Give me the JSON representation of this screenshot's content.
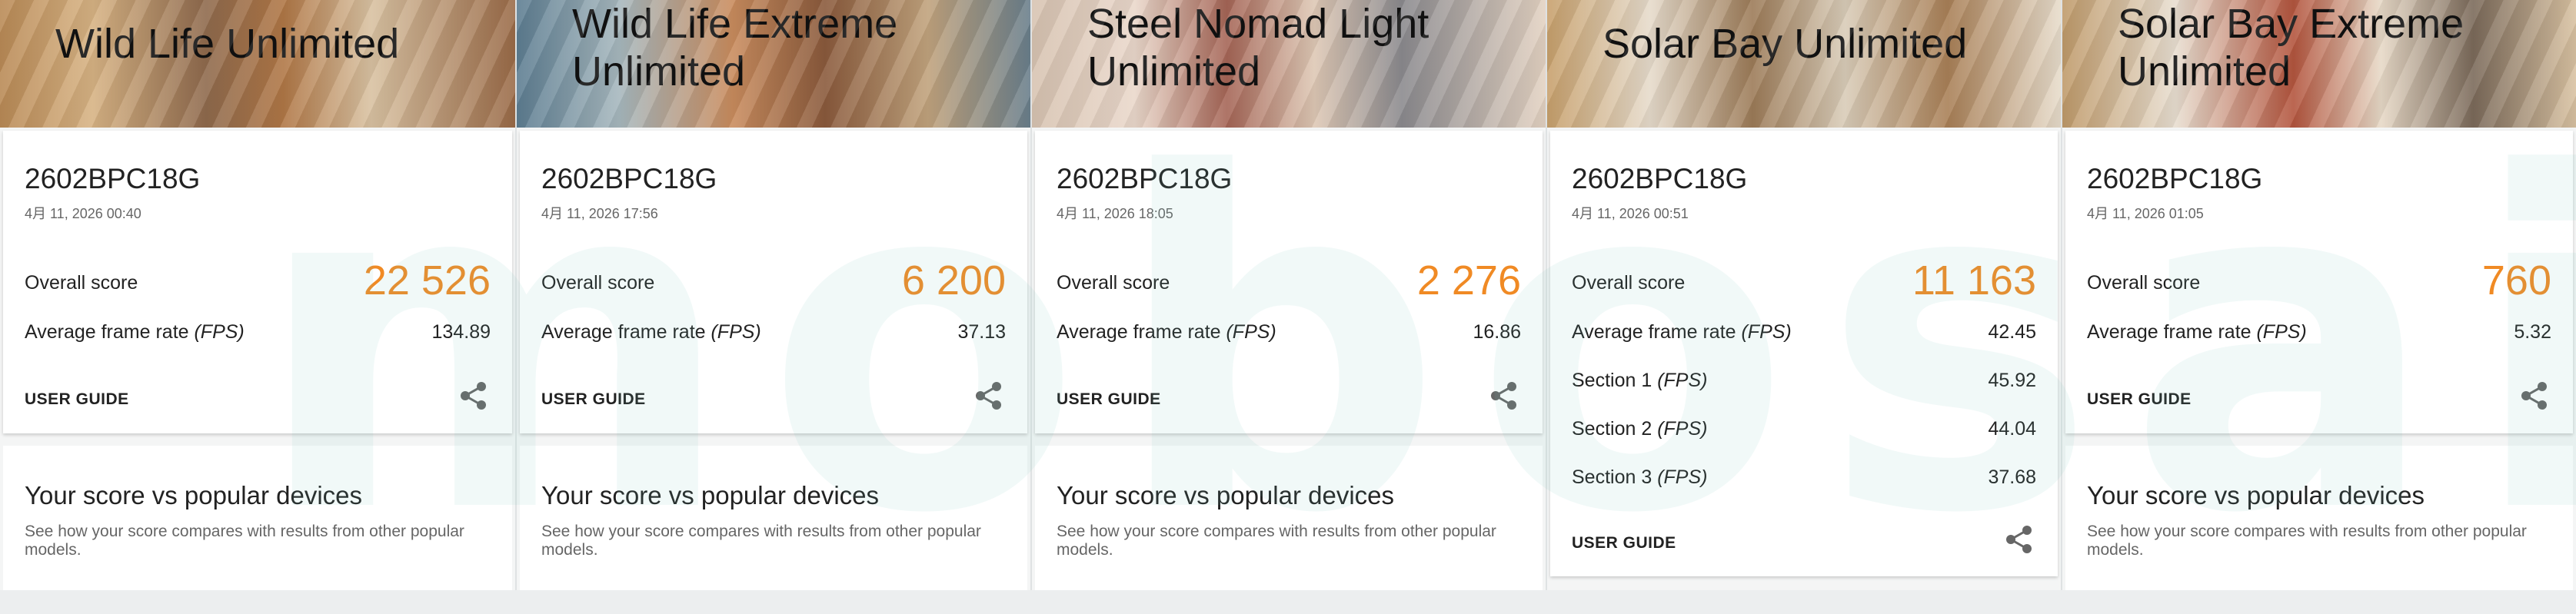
{
  "watermark": "mobosai",
  "panels": [
    {
      "title": "Wild Life Unlimited",
      "device": "2602BPC18G",
      "date": "4月 11, 2026 00:40",
      "score_label": "Overall score",
      "score": "22 526",
      "fps_label": "Average frame rate ",
      "fps_unit": "(FPS)",
      "fps": "134.89",
      "user_guide": "USER GUIDE",
      "compare_title": "Your score vs popular devices",
      "compare_desc": "See how your score compares with results from other popular models."
    },
    {
      "title": "Wild Life Extreme\nUnlimited",
      "device": "2602BPC18G",
      "date": "4月 11, 2026 17:56",
      "score_label": "Overall score",
      "score": "6 200",
      "fps_label": "Average frame rate ",
      "fps_unit": "(FPS)",
      "fps": "37.13",
      "user_guide": "USER GUIDE",
      "compare_title": "Your score vs popular devices",
      "compare_desc": "See how your score compares with results from other popular models."
    },
    {
      "title": "Steel Nomad Light\nUnlimited",
      "device": "2602BPC18G",
      "date": "4月 11, 2026 18:05",
      "score_label": "Overall score",
      "score": "2 276",
      "fps_label": "Average frame rate ",
      "fps_unit": "(FPS)",
      "fps": "16.86",
      "user_guide": "USER GUIDE",
      "compare_title": "Your score vs popular devices",
      "compare_desc": "See how your score compares with results from other popular models."
    },
    {
      "title": "Solar Bay Unlimited",
      "device": "2602BPC18G",
      "date": "4月 11, 2026 00:51",
      "score_label": "Overall score",
      "score": "11 163",
      "fps_label": "Average frame rate ",
      "fps_unit": "(FPS)",
      "fps": "42.45",
      "sections": [
        {
          "label": "Section 1 ",
          "unit": "(FPS)",
          "value": "45.92"
        },
        {
          "label": "Section 2 ",
          "unit": "(FPS)",
          "value": "44.04"
        },
        {
          "label": "Section 3 ",
          "unit": "(FPS)",
          "value": "37.68"
        }
      ],
      "user_guide": "USER GUIDE"
    },
    {
      "title": "Solar Bay Extreme\nUnlimited",
      "device": "2602BPC18G",
      "date": "4月 11, 2026 01:05",
      "score_label": "Overall score",
      "score": "760",
      "fps_label": "Average frame rate ",
      "fps_unit": "(FPS)",
      "fps": "5.32",
      "user_guide": "USER GUIDE",
      "compare_title": "Your score vs popular devices",
      "compare_desc": "See how your score compares with results from other popular models."
    }
  ],
  "colors": {
    "score_accent": "#f08a24",
    "card_bg": "#ffffff",
    "page_bg": "#eceeef"
  },
  "icons": {
    "share": "share-icon"
  }
}
